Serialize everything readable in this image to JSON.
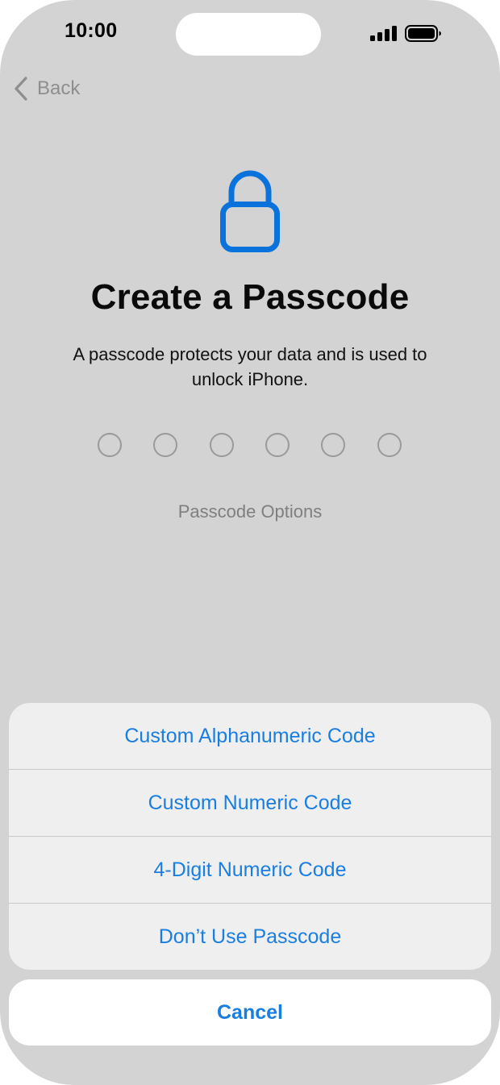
{
  "status_bar": {
    "time": "10:00",
    "signal_icon": "cellular-signal-icon",
    "battery_icon": "battery-icon"
  },
  "nav": {
    "back_label": "Back",
    "back_icon": "chevron-left-icon"
  },
  "hero": {
    "icon": "lock-icon",
    "title": "Create a Passcode",
    "subtitle": "A passcode protects your data and is used to unlock iPhone.",
    "passcode_dots": 6,
    "options_link": "Passcode Options"
  },
  "action_sheet": {
    "items": [
      {
        "label": "Custom Alphanumeric Code"
      },
      {
        "label": "Custom Numeric Code"
      },
      {
        "label": "4-Digit Numeric Code"
      },
      {
        "label": "Don’t Use Passcode"
      }
    ],
    "cancel_label": "Cancel"
  },
  "colors": {
    "accent": "#1a7ee0",
    "background": "#d3d3d3",
    "sheet": "#efefef"
  }
}
